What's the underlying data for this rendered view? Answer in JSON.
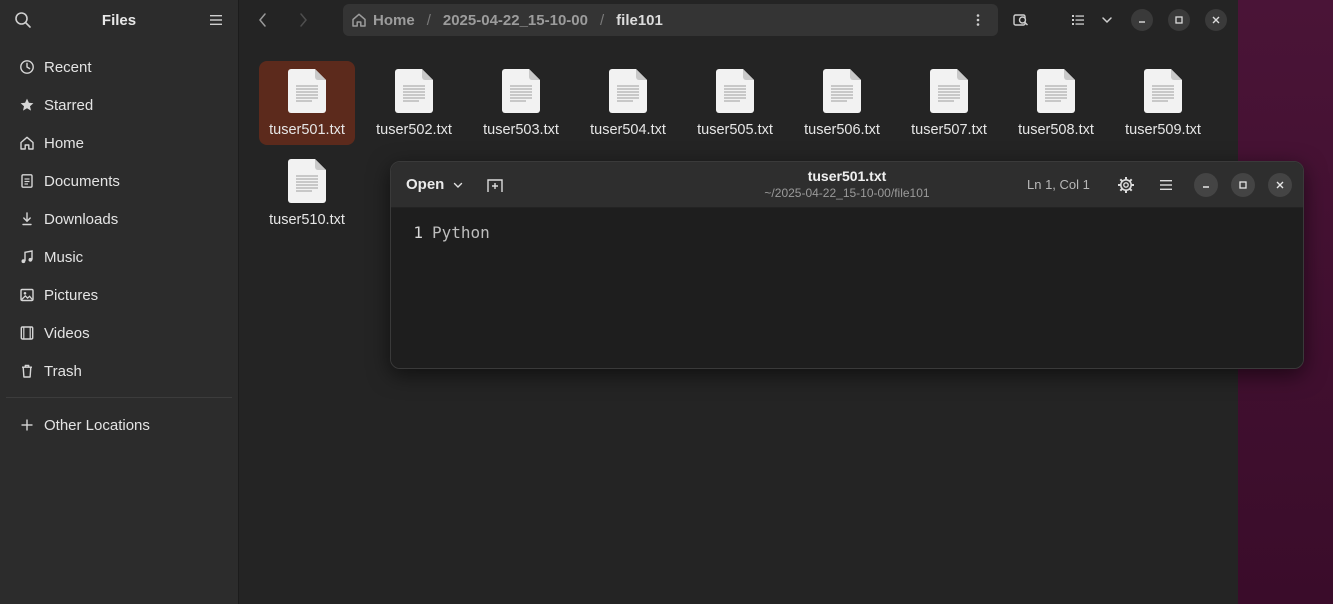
{
  "files": {
    "app_title": "Files",
    "sidebar": {
      "places": [
        {
          "label": "Recent",
          "icon": "clock-icon"
        },
        {
          "label": "Starred",
          "icon": "star-icon"
        },
        {
          "label": "Home",
          "icon": "home-icon"
        },
        {
          "label": "Documents",
          "icon": "document-icon"
        },
        {
          "label": "Downloads",
          "icon": "download-icon"
        },
        {
          "label": "Music",
          "icon": "music-icon"
        },
        {
          "label": "Pictures",
          "icon": "picture-icon"
        },
        {
          "label": "Videos",
          "icon": "video-icon"
        },
        {
          "label": "Trash",
          "icon": "trash-icon"
        }
      ],
      "other_locations": "Other Locations"
    },
    "breadcrumb": [
      "Home",
      "2025-04-22_15-10-00",
      "file101"
    ],
    "items": [
      {
        "name": "tuser501.txt",
        "selected": true
      },
      {
        "name": "tuser502.txt",
        "selected": false
      },
      {
        "name": "tuser503.txt",
        "selected": false
      },
      {
        "name": "tuser504.txt",
        "selected": false
      },
      {
        "name": "tuser505.txt",
        "selected": false
      },
      {
        "name": "tuser506.txt",
        "selected": false
      },
      {
        "name": "tuser507.txt",
        "selected": false
      },
      {
        "name": "tuser508.txt",
        "selected": false
      },
      {
        "name": "tuser509.txt",
        "selected": false
      },
      {
        "name": "tuser510.txt",
        "selected": false
      }
    ]
  },
  "editor": {
    "open_label": "Open",
    "title": "tuser501.txt",
    "subtitle": "~/2025-04-22_15-10-00/file101",
    "cursor_position": "Ln 1, Col  1",
    "lines": [
      {
        "number": "1",
        "text": "Python"
      }
    ]
  },
  "colors": {
    "selection": "#5c2a1c",
    "window_bg": "#242424",
    "sidebar_bg": "#2c2c2c",
    "desktop": "#3b0d2b"
  }
}
